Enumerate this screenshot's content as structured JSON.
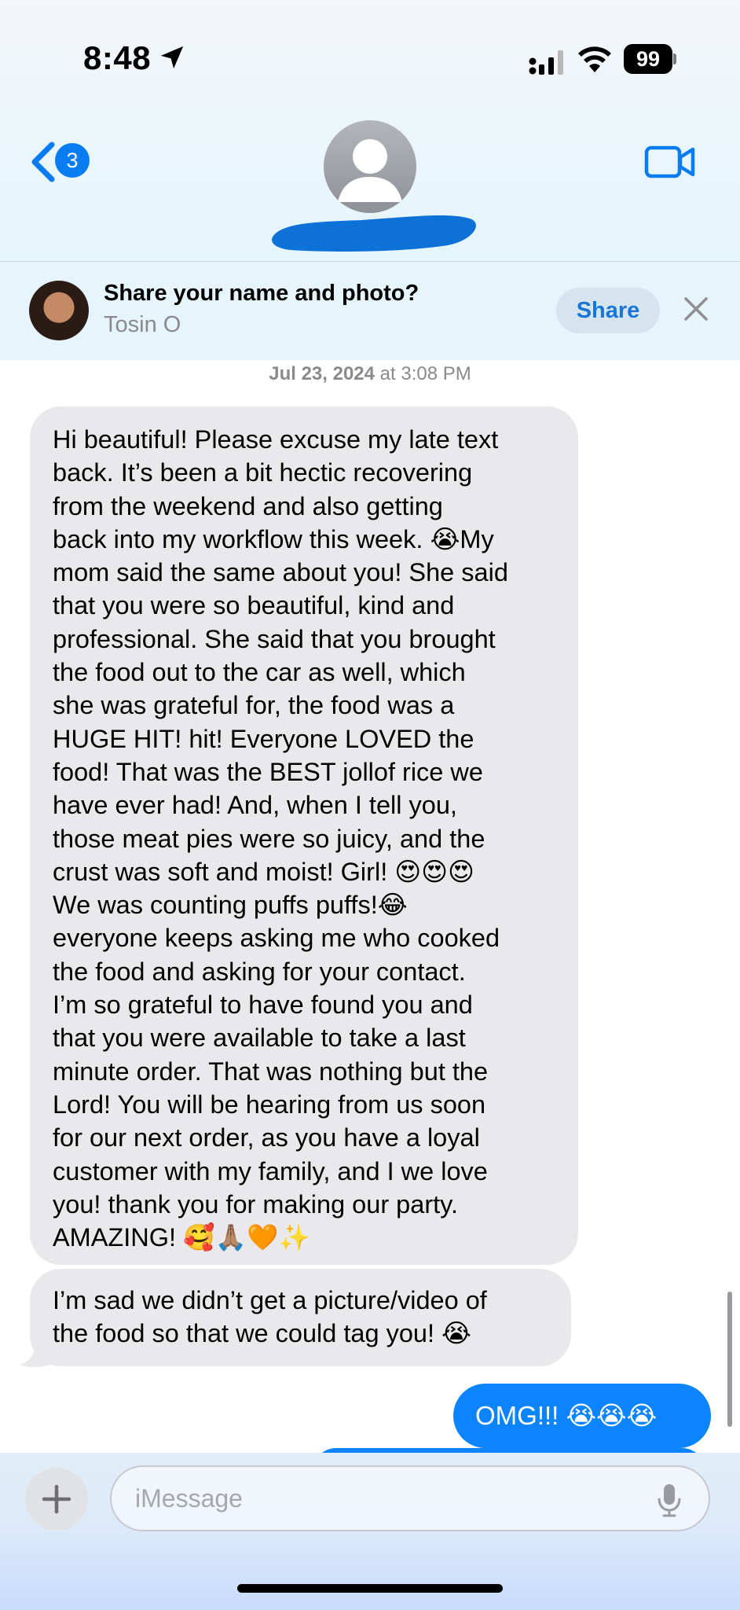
{
  "status_bar": {
    "time": "8:48",
    "battery": "99"
  },
  "nav": {
    "back_badge": "3"
  },
  "share_banner": {
    "title": "Share your name and photo?",
    "subtitle": "Tosin O",
    "share_label": "Share"
  },
  "timestamp": {
    "date": "Jul 23, 2024",
    "at": " at ",
    "time": "3:08 PM"
  },
  "messages": [
    {
      "direction": "incoming",
      "lines": [
        "Hi beautiful! Please excuse my late text",
        "back. It’s been a bit hectic recovering",
        "from the weekend and also getting",
        "back into my workflow this week. 😭My",
        "mom said the same about you! She said",
        "that you were so beautiful, kind and",
        "professional. She said that you brought",
        "the food out to the car as well, which",
        "she was grateful for, the food was a",
        "HUGE HIT! hit! Everyone LOVED the",
        "food! That was the BEST jollof rice we",
        "have ever had! And, when I tell you,",
        "those meat pies were so juicy, and the",
        "crust was soft and moist! Girl! 😍😍😍",
        "We was counting puffs puffs!😂",
        "everyone keeps asking me who cooked",
        "the food and asking for your contact.",
        "I’m so grateful to have found you and",
        "that you were available to take a last",
        "minute order. That was nothing but the",
        "Lord! You will be hearing from us soon",
        "for our next order, as you have a loyal",
        "customer with my family, and I we love",
        "you! thank you for making our party.",
        "AMAZING! 🥰🙏🏽🧡✨"
      ]
    },
    {
      "direction": "incoming",
      "lines": [
        "I’m sad we didn’t get a picture/video of",
        "the food so that we could tag you! 😭"
      ]
    },
    {
      "direction": "outgoing",
      "text": "OMG!!! 😭😭😭"
    }
  ],
  "composer": {
    "placeholder": "iMessage"
  },
  "icons": {
    "back": "chevron-left-icon",
    "video": "video-camera-icon",
    "close": "close-icon",
    "add": "plus-icon",
    "mic": "microphone-icon",
    "location": "location-arrow-icon",
    "signal": "cellular-signal-icon",
    "wifi": "wifi-icon"
  },
  "colors": {
    "accent": "#0b84fe",
    "incoming_bubble": "#e9e9eb",
    "header_bg": "#eaf6fb",
    "secondary_text": "#8a8a8e"
  }
}
